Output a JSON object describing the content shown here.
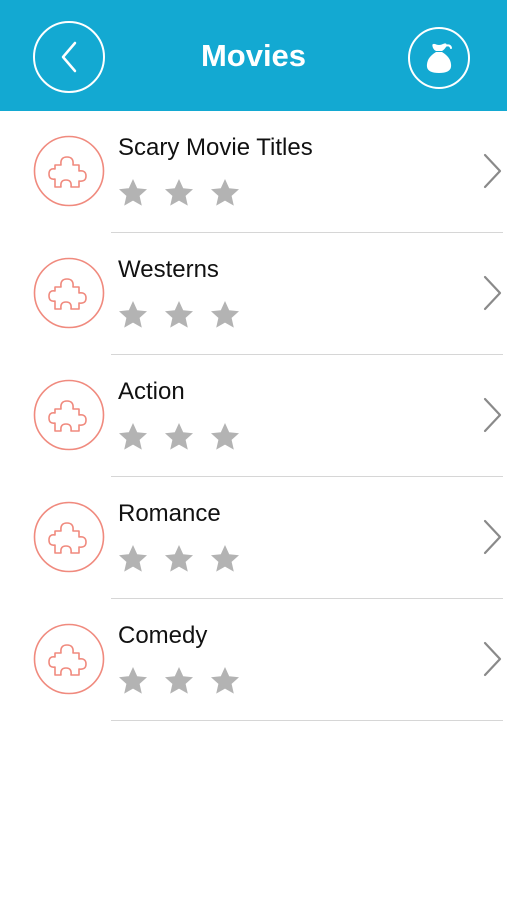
{
  "header": {
    "title": "Movies",
    "back_icon": "chevron-left-icon",
    "right_icon": "money-bag-icon",
    "background_color": "#13a9d2"
  },
  "categories": [
    {
      "label": "Scary Movie Titles",
      "stars": 0,
      "stars_total": 3,
      "icon": "puzzle-piece-icon"
    },
    {
      "label": "Westerns",
      "stars": 0,
      "stars_total": 3,
      "icon": "puzzle-piece-icon"
    },
    {
      "label": "Action",
      "stars": 0,
      "stars_total": 3,
      "icon": "puzzle-piece-icon"
    },
    {
      "label": "Romance",
      "stars": 0,
      "stars_total": 3,
      "icon": "puzzle-piece-icon"
    },
    {
      "label": "Comedy",
      "stars": 0,
      "stars_total": 3,
      "icon": "puzzle-piece-icon"
    }
  ],
  "colors": {
    "badge_accent": "#f08a7e",
    "star_empty": "#b3b3b3",
    "chevron": "#8a8a8a"
  }
}
